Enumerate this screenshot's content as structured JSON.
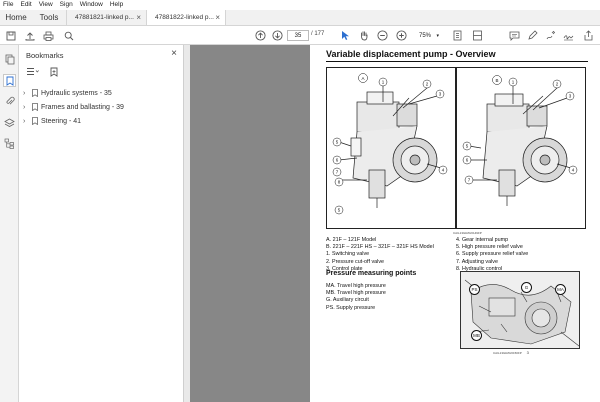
{
  "menu": [
    "File",
    "Edit",
    "View",
    "Sign",
    "Window",
    "Help"
  ],
  "tabs": {
    "home": "Home",
    "tools": "Tools",
    "docs": [
      {
        "label": "47881821-linked p...",
        "active": false
      },
      {
        "label": "47881822-linked p...",
        "active": true
      }
    ]
  },
  "toolbar": {
    "page_current": "35",
    "page_total": "/ 177",
    "zoom": "75%"
  },
  "bookmarks": {
    "title": "Bookmarks",
    "items": [
      {
        "label": "Hydraulic systems - 35"
      },
      {
        "label": "Frames and ballasting - 39"
      },
      {
        "label": "Steering - 41"
      }
    ]
  },
  "document": {
    "title": "Variable displacement pump - Overview",
    "figure_caption": "CAIL13GRAV0149FP",
    "photo_caption": "CAIL13GRAV0150FP",
    "legend_left": [
      "A. 21F – 121F Model",
      "B. 221F – 221F HS – 321F – 321F HS Model",
      "1.  Switching valve",
      "2.  Pressure cut-off valve",
      "3.  Control plate"
    ],
    "legend_right": [
      "4.  Gear internal pump",
      "5.  High pressure relief valve",
      "6.  Supply pressure relief valve",
      "7.  Adjusting valve",
      "8.  Hydraulic control"
    ],
    "section_title": "Pressure measuring points",
    "pressure_points": [
      "MA.  Travel high pressure",
      "MB.  Travel high pressure",
      "G.  Auxiliary circuit",
      "PS.  Supply pressure"
    ],
    "photo_markers": [
      "PS",
      "G",
      "MA",
      "MB"
    ],
    "figure_a_label": "A",
    "figure_b_label": "B",
    "callouts": [
      "1",
      "2",
      "3",
      "4",
      "5",
      "6",
      "7",
      "8"
    ],
    "photo_number": "3"
  }
}
